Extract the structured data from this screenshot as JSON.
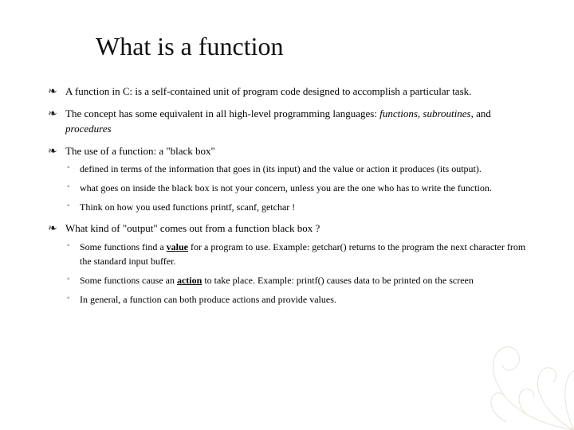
{
  "title": "What is a function",
  "bullets": {
    "b1": "A function in C: is a self-contained unit of program code designed to accomplish a particular task.",
    "b2_pre": "The concept has some equivalent in all high-level programming languages: ",
    "b2_ital": "functions, subroutines,",
    "b2_post": " and ",
    "b2_ital2": "procedures",
    "b3": "The use of a function: a \"black box\"",
    "b3_sub1": "defined in terms of the information that goes in (its input) and the value or action it produces (its output).",
    "b3_sub2": "what goes on inside the black box is not your concern, unless you are the one who has to write the function.",
    "b3_sub3": "Think on how you used functions printf, scanf, getchar !",
    "b4": "What kind of \"output\" comes out from a function black box ?",
    "b4_sub1_pre": "Some functions find a ",
    "b4_sub1_bold": "value",
    "b4_sub1_post": " for a program to use. Example:  getchar() returns to the program the next character from the standard input buffer.",
    "b4_sub2_pre": "Some functions cause an ",
    "b4_sub2_bold": "action",
    "b4_sub2_post": " to take place. Example: printf() causes data to be printed on the screen",
    "b4_sub3": "In general, a function can both produce actions and provide values."
  }
}
